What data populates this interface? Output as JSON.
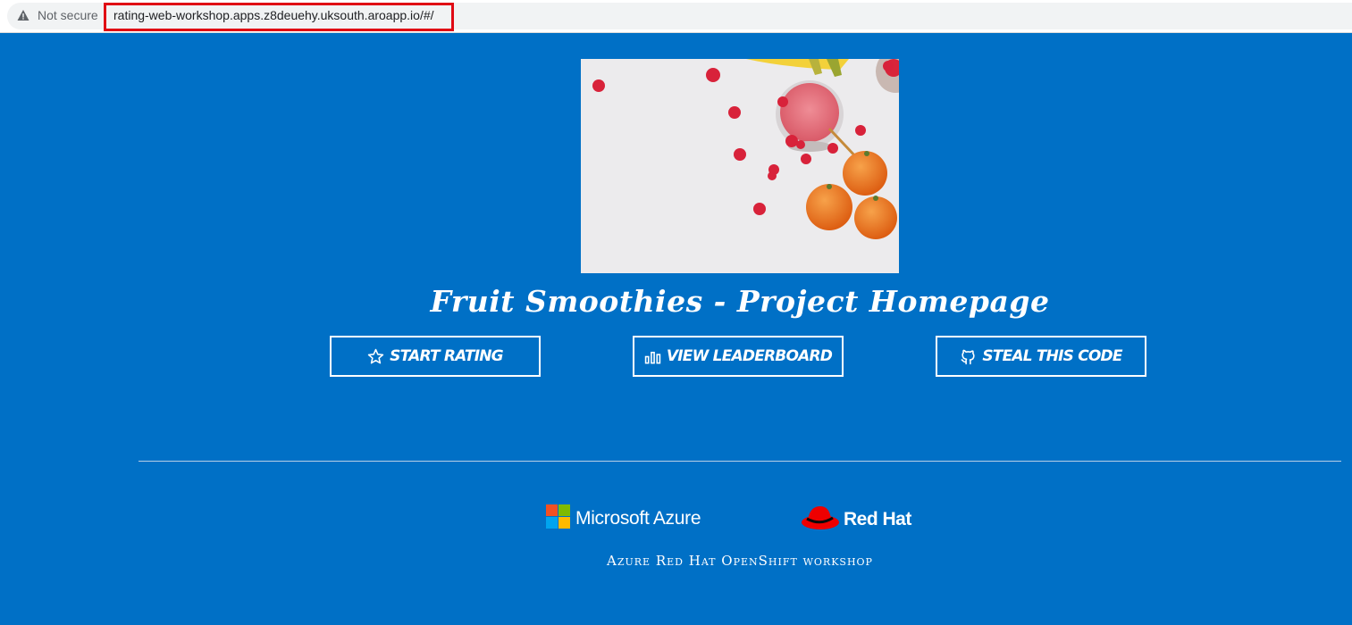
{
  "browser": {
    "security_label": "Not secure",
    "url": "rating-web-workshop.apps.z8deuehy.uksouth.aroapp.io/#/",
    "icons": {
      "security": "warning-triangle-icon"
    },
    "colors": {
      "highlight": "#e00a14"
    }
  },
  "page": {
    "background": "#0070c6",
    "title": "Fruit Smoothies - Project Homepage",
    "hero_image": "smoothie-with-raspberries-and-oranges",
    "actions": [
      {
        "label": "START RATING",
        "icon": "star-icon"
      },
      {
        "label": "VIEW LEADERBOARD",
        "icon": "bar-chart-icon"
      },
      {
        "label": "STEAL THIS CODE",
        "icon": "github-icon"
      }
    ]
  },
  "footer": {
    "azure_label": "Microsoft Azure",
    "redhat_label": "Red Hat",
    "caption": "Azure Red Hat OpenShift workshop",
    "colors": {
      "ms_red": "#f25022",
      "ms_green": "#7fba00",
      "ms_blue": "#00a4ef",
      "ms_yellow": "#ffb900",
      "redhat_red": "#ee0000"
    }
  }
}
